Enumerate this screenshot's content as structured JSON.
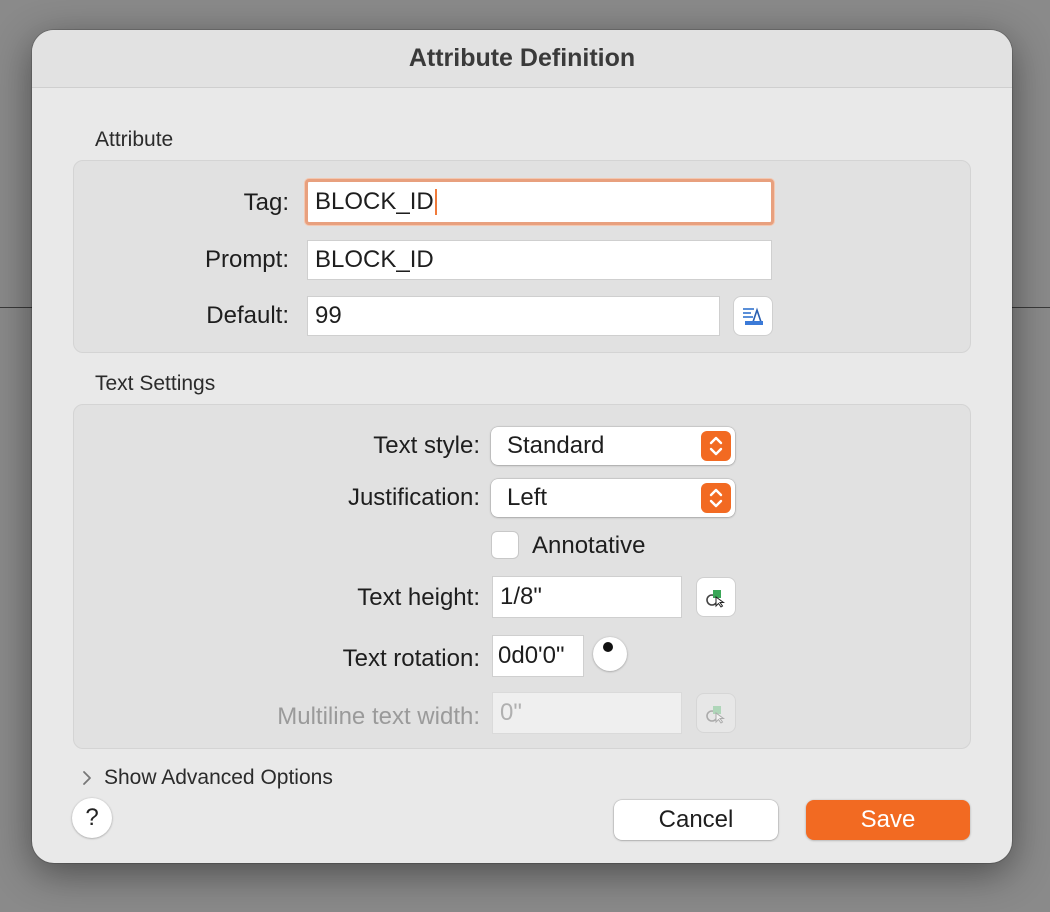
{
  "dialog": {
    "title": "Attribute Definition"
  },
  "attribute": {
    "section_label": "Attribute",
    "tag": {
      "label": "Tag:",
      "value": "BLOCK_ID"
    },
    "prompt": {
      "label": "Prompt:",
      "value": "BLOCK_ID"
    },
    "default": {
      "label": "Default:",
      "value": "99",
      "button_icon": "insert-field-icon"
    }
  },
  "text_settings": {
    "section_label": "Text Settings",
    "text_style": {
      "label": "Text style:",
      "value": "Standard"
    },
    "justification": {
      "label": "Justification:",
      "value": "Left"
    },
    "annotative": {
      "label": "Annotative",
      "checked": false
    },
    "text_height": {
      "label": "Text height:",
      "value": "1/8\"",
      "button_icon": "pick-point-icon"
    },
    "text_rotation": {
      "label": "Text rotation:",
      "value": "0d0'0\"",
      "dial_icon": "rotation-dial-icon"
    },
    "multiline_width": {
      "label": "Multiline text width:",
      "value": "0\"",
      "disabled": true,
      "button_icon": "pick-point-icon"
    }
  },
  "advanced": {
    "label": "Show Advanced Options",
    "expanded": false
  },
  "footer": {
    "help_label": "?",
    "cancel_label": "Cancel",
    "save_label": "Save"
  },
  "colors": {
    "accent": "#f26a22",
    "focus_ring": "#e8a07e",
    "dialog_bg": "#e9e9e9"
  }
}
